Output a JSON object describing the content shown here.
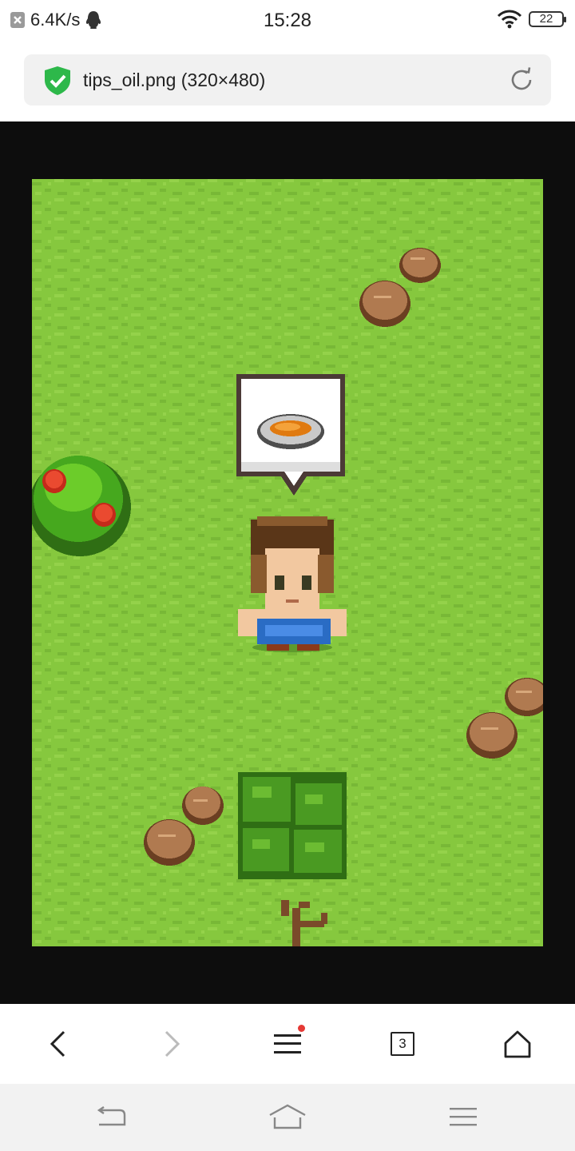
{
  "status_bar": {
    "network_speed": "6.4K/s",
    "time": "15:28",
    "battery_level": "22"
  },
  "address_bar": {
    "title": "tips_oil.png (320×480)",
    "secure": true
  },
  "game_scene": {
    "speech_bubble_icon": "bowl-of-oil-icon",
    "ground_color": "#86c83e",
    "objects": [
      "rock",
      "rock",
      "berry-bush",
      "character",
      "rock",
      "rock",
      "rock",
      "rock",
      "leafy-bush",
      "branch"
    ]
  },
  "bottom_nav": {
    "tab_count": "3",
    "has_notification": true
  },
  "colors": {
    "viewer_background": "#0d0d0d",
    "secure_icon": "#2db84a",
    "notification_dot": "#e53935"
  }
}
